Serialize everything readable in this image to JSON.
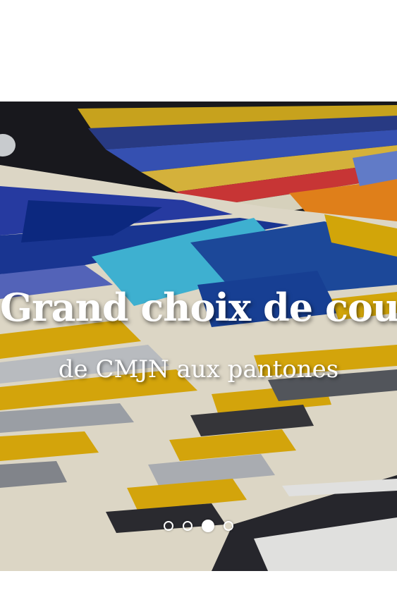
{
  "slider": {
    "headline": "Grand choix de couleurs",
    "subheadline": "de CMJN aux pantones",
    "active_slide": 3,
    "slide_count": 4,
    "image_alt": "swatch-cards-photo"
  },
  "colors": {
    "background": "#ffffff",
    "text": "#ffffff",
    "swatch_blue": "#1d4fa3",
    "swatch_cyan": "#45bde0",
    "swatch_yellow": "#e8b40c",
    "swatch_orange": "#f28a1d",
    "swatch_gray": "#9a9ea3"
  }
}
